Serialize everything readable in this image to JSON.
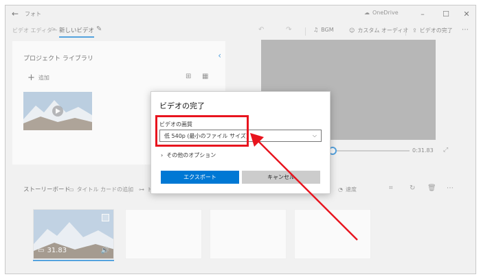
{
  "titlebar": {
    "app_title": "フォト",
    "onedrive": "OneDrive"
  },
  "toolbar": {
    "crumb_root": "ビデオ エディター",
    "crumb_sep": ">",
    "crumb_current": "新しいビデオ",
    "bgm_label": "BGM",
    "custom_audio_label": "カスタム オーディオ",
    "finish_label": "ビデオの完了"
  },
  "library": {
    "title": "プロジェクト ライブラリ",
    "add_label": "追加"
  },
  "preview": {
    "time": "0:31.83"
  },
  "storyboard": {
    "title": "ストーリーボード",
    "add_title_card": "タイトル カードの追加",
    "trim_partial": "トリ",
    "speed_label": "速度",
    "clip_duration": "31.83"
  },
  "dialog": {
    "title": "ビデオの完了",
    "quality_label": "ビデオの画質",
    "quality_value": "低 540p (最小のファイル サイズ)",
    "more_options": "その他のオプション",
    "export_label": "エクスポート",
    "cancel_label": "キャンセル"
  },
  "colors": {
    "accent": "#0078d4",
    "annotation": "#e8141e"
  }
}
